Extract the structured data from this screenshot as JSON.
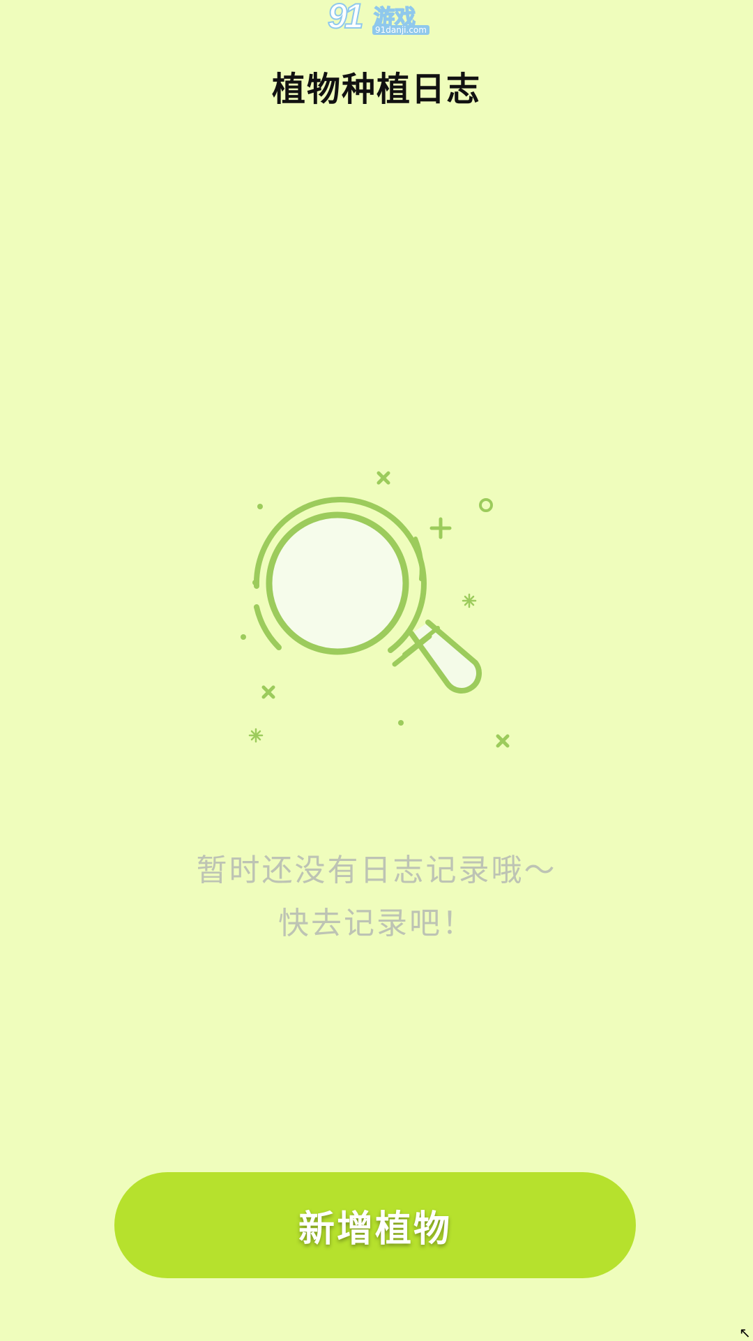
{
  "watermark": {
    "brand_number": "91",
    "brand_name": "游戏",
    "site": "91danji.com"
  },
  "header": {
    "title": "植物种植日志"
  },
  "empty_state": {
    "icon": "magnifier-icon",
    "line1": "暂时还没有日志记录哦～",
    "line2": "快去记录吧！"
  },
  "actions": {
    "add_plant_label": "新增植物"
  },
  "colors": {
    "background": "#EFFDBC",
    "accent": "#B6E12D",
    "icon_green": "#9CCB5C",
    "hint_text": "#BDC3B4"
  }
}
